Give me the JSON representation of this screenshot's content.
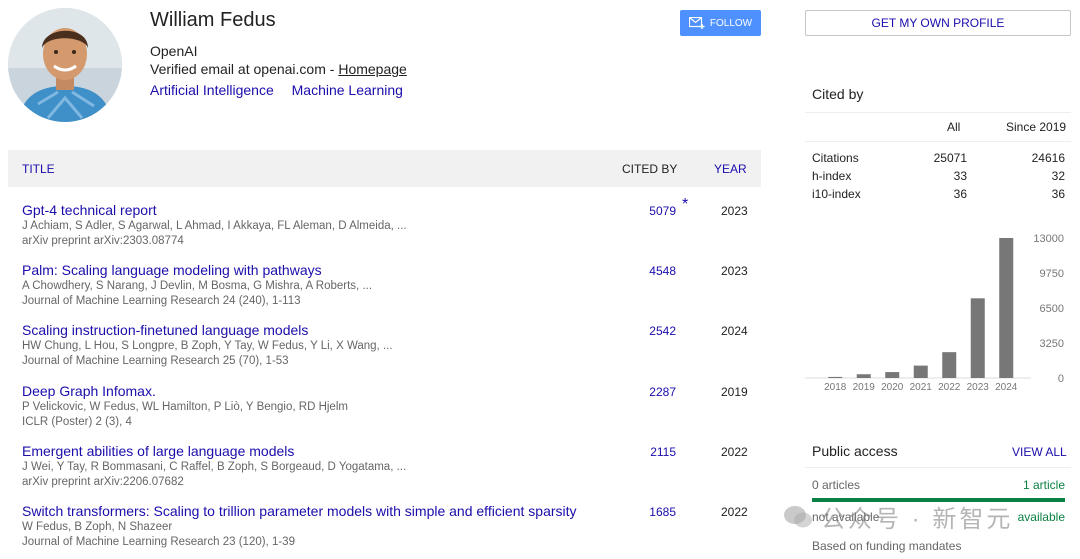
{
  "profile": {
    "name": "William Fedus",
    "affiliation": "OpenAI",
    "email_text": "Verified email at openai.com - ",
    "homepage_label": "Homepage",
    "interests": [
      "Artificial Intelligence",
      "Machine Learning"
    ],
    "follow_label": "FOLLOW"
  },
  "table": {
    "headers": {
      "title": "TITLE",
      "cited_by": "CITED BY",
      "year": "YEAR"
    },
    "rows": [
      {
        "title": "Gpt-4 technical report",
        "authors": "J Achiam, S Adler, S Agarwal, L Ahmad, I Akkaya, FL Aleman, D Almeida, ...",
        "venue": "arXiv preprint arXiv:2303.08774",
        "cited": "5079",
        "star": "*",
        "year": "2023"
      },
      {
        "title": "Palm: Scaling language modeling with pathways",
        "authors": "A Chowdhery, S Narang, J Devlin, M Bosma, G Mishra, A Roberts, ...",
        "venue": "Journal of Machine Learning Research 24 (240), 1-113",
        "cited": "4548",
        "star": "",
        "year": "2023"
      },
      {
        "title": "Scaling instruction-finetuned language models",
        "authors": "HW Chung, L Hou, S Longpre, B Zoph, Y Tay, W Fedus, Y Li, X Wang, ...",
        "venue": "Journal of Machine Learning Research 25 (70), 1-53",
        "cited": "2542",
        "star": "",
        "year": "2024"
      },
      {
        "title": "Deep Graph Infomax.",
        "authors": "P Velickovic, W Fedus, WL Hamilton, P Liò, Y Bengio, RD Hjelm",
        "venue": "ICLR (Poster) 2 (3), 4",
        "cited": "2287",
        "star": "",
        "year": "2019"
      },
      {
        "title": "Emergent abilities of large language models",
        "authors": "J Wei, Y Tay, R Bommasani, C Raffel, B Zoph, S Borgeaud, D Yogatama, ...",
        "venue": "arXiv preprint arXiv:2206.07682",
        "cited": "2115",
        "star": "",
        "year": "2022"
      },
      {
        "title": "Switch transformers: Scaling to trillion parameter models with simple and efficient sparsity",
        "authors": "W Fedus, B Zoph, N Shazeer",
        "venue": "Journal of Machine Learning Research 23 (120), 1-39",
        "cited": "1685",
        "star": "",
        "year": "2022"
      }
    ]
  },
  "sidebar": {
    "own_profile_label": "GET MY OWN PROFILE",
    "cited_by_title": "Cited by",
    "col_all": "All",
    "col_since": "Since 2019",
    "metrics": [
      {
        "label": "Citations",
        "all": "25071",
        "since": "24616"
      },
      {
        "label": "h-index",
        "all": "33",
        "since": "32"
      },
      {
        "label": "i10-index",
        "all": "36",
        "since": "36"
      }
    ],
    "public_access": {
      "title": "Public access",
      "view_all": "VIEW ALL",
      "zero_articles": "0 articles",
      "one_article": "1 article",
      "not_available": "not available",
      "available": "available",
      "funding": "Based on funding mandates"
    },
    "watermark": "公众号 · 新智元"
  },
  "chart_data": {
    "type": "bar",
    "categories": [
      "2018",
      "2019",
      "2020",
      "2021",
      "2022",
      "2023",
      "2024"
    ],
    "values": [
      100,
      350,
      550,
      1150,
      2400,
      7400,
      13000
    ],
    "y_ticks": [
      "13000",
      "9750",
      "6500",
      "3250",
      "0"
    ],
    "ylim": [
      0,
      13000
    ],
    "bar_color": "#777777"
  }
}
